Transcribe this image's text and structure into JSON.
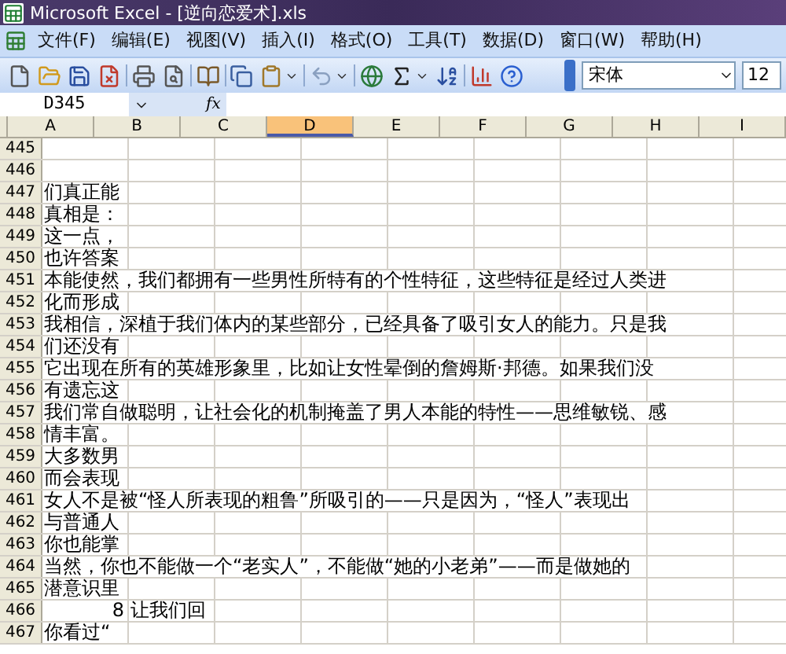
{
  "window": {
    "title": "Microsoft Excel - [逆向恋爱术].xls"
  },
  "menu": [
    "文件(F)",
    "编辑(E)",
    "视图(V)",
    "插入(I)",
    "格式(O)",
    "工具(T)",
    "数据(D)",
    "窗口(W)",
    "帮助(H)"
  ],
  "toolbar": {
    "font": "宋体",
    "size": "12"
  },
  "formula_bar": {
    "name_box": "D345",
    "fx": "fx"
  },
  "columns": [
    {
      "label": "A",
      "selected": false
    },
    {
      "label": "B",
      "selected": false
    },
    {
      "label": "C",
      "selected": false
    },
    {
      "label": "D",
      "selected": true
    },
    {
      "label": "E",
      "selected": false
    },
    {
      "label": "F",
      "selected": false
    },
    {
      "label": "G",
      "selected": false
    },
    {
      "label": "H",
      "selected": false
    },
    {
      "label": "I",
      "selected": false
    }
  ],
  "rows": [
    {
      "number": "445",
      "cells": []
    },
    {
      "number": "446",
      "cells": []
    },
    {
      "number": "447",
      "cells": [
        {
          "kind": "text",
          "text": "们真正能"
        }
      ]
    },
    {
      "number": "448",
      "cells": [
        {
          "kind": "text",
          "text": "真相是："
        }
      ]
    },
    {
      "number": "449",
      "cells": [
        {
          "kind": "text",
          "text": "这一点，"
        }
      ]
    },
    {
      "number": "450",
      "cells": [
        {
          "kind": "text",
          "text": "也许答案"
        }
      ]
    },
    {
      "number": "451",
      "cells": [
        {
          "kind": "text",
          "text": "本能使然，我们都拥有一些男性所特有的个性特征，这些特征是经过人类进"
        }
      ]
    },
    {
      "number": "452",
      "cells": [
        {
          "kind": "text",
          "text": "化而形成"
        }
      ]
    },
    {
      "number": "453",
      "cells": [
        {
          "kind": "text",
          "text": "我相信，深植于我们体内的某些部分，已经具备了吸引女人的能力。只是我"
        }
      ]
    },
    {
      "number": "454",
      "cells": [
        {
          "kind": "text",
          "text": "们还没有"
        }
      ]
    },
    {
      "number": "455",
      "cells": [
        {
          "kind": "text",
          "text": "它出现在所有的英雄形象里，比如让女性晕倒的詹姆斯·邦德。如果我们没"
        }
      ]
    },
    {
      "number": "456",
      "cells": [
        {
          "kind": "text",
          "text": "有遗忘这"
        }
      ]
    },
    {
      "number": "457",
      "cells": [
        {
          "kind": "text",
          "text": "我们常自做聪明，让社会化的机制掩盖了男人本能的特性——思维敏锐、感"
        }
      ]
    },
    {
      "number": "458",
      "cells": [
        {
          "kind": "text",
          "text": "情丰富。"
        }
      ]
    },
    {
      "number": "459",
      "cells": [
        {
          "kind": "text",
          "text": "大多数男"
        }
      ]
    },
    {
      "number": "460",
      "cells": [
        {
          "kind": "text",
          "text": "而会表现"
        }
      ]
    },
    {
      "number": "461",
      "cells": [
        {
          "kind": "text",
          "text": "女人不是被“怪人所表现的粗鲁”所吸引的——只是因为，“怪人”表现出"
        }
      ]
    },
    {
      "number": "462",
      "cells": [
        {
          "kind": "text",
          "text": "与普通人"
        }
      ]
    },
    {
      "number": "463",
      "cells": [
        {
          "kind": "text",
          "text": "你也能掌"
        }
      ]
    },
    {
      "number": "464",
      "cells": [
        {
          "kind": "text",
          "text": "当然，你也不能做一个“老实人”，不能做“她的小老弟”——而是做她的"
        }
      ]
    },
    {
      "number": "465",
      "cells": [
        {
          "kind": "text",
          "text": "潜意识里"
        }
      ]
    },
    {
      "number": "466",
      "cells": [
        {
          "kind": "number",
          "text": "8"
        },
        {
          "kind": "text",
          "text": "让我们回"
        }
      ]
    },
    {
      "number": "467",
      "cells": [
        {
          "kind": "text",
          "text": "你看过“"
        }
      ]
    }
  ]
}
